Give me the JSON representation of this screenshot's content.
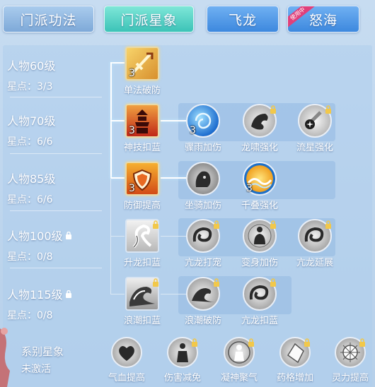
{
  "tabs": [
    {
      "label": "门派功法"
    },
    {
      "label": "门派星象"
    },
    {
      "label": "飞龙"
    },
    {
      "label": "怒海",
      "badge": "使用中"
    }
  ],
  "levels": [
    {
      "label": "人物60级",
      "points": "星点：3/3"
    },
    {
      "label": "人物70级",
      "points": "星点：6/6"
    },
    {
      "label": "人物85级",
      "points": "星点：6/6"
    },
    {
      "label": "人物100级",
      "points": "星点：0/8",
      "locked": true
    },
    {
      "label": "人物115级",
      "points": "星点：0/8",
      "locked": true
    }
  ],
  "skills": {
    "r1": [
      {
        "name": "单法破防",
        "level": "3",
        "icon": "sword-icon"
      }
    ],
    "r2": [
      {
        "name": "神技扣蓝",
        "level": "3",
        "icon": "pagoda-fire-icon"
      },
      {
        "name": "骤雨加伤",
        "level": "3",
        "icon": "swirl-orb-icon"
      },
      {
        "name": "龙啸强化",
        "level": "",
        "icon": "dragon-head-icon",
        "locked": true
      },
      {
        "name": "流星强化",
        "level": "",
        "icon": "meteor-icon",
        "locked": true
      }
    ],
    "r3": [
      {
        "name": "防御提高",
        "level": "3",
        "icon": "shield-fire-icon"
      },
      {
        "name": "坐骑加伤",
        "level": "",
        "icon": "beast-icon"
      },
      {
        "name": "千叠强化",
        "level": "3",
        "icon": "wave-icon"
      }
    ],
    "r4": [
      {
        "name": "升龙扣蓝",
        "level": "",
        "icon": "rising-dragon-icon",
        "locked": true
      },
      {
        "name": "亢龙打宠",
        "level": "",
        "icon": "coiled-dragon-icon",
        "locked": true
      },
      {
        "name": "变身加伤",
        "level": "",
        "icon": "meditate-figure-icon",
        "locked": true
      },
      {
        "name": "亢龙延展",
        "level": "",
        "icon": "coiled-dragon-icon",
        "locked": true
      }
    ],
    "r5": [
      {
        "name": "浪潮扣蓝",
        "level": "",
        "icon": "tidal-wave-icon",
        "locked": true
      },
      {
        "name": "浪潮破防",
        "level": "",
        "icon": "tidal-wave-icon",
        "locked": true
      },
      {
        "name": "亢龙扣蓝",
        "level": "",
        "icon": "coiled-dragon-icon",
        "locked": true
      }
    ]
  },
  "series": {
    "title": "系别星象",
    "status": "未激活",
    "items": [
      {
        "name": "气血提高",
        "icon": "heart-icon"
      },
      {
        "name": "伤害减免",
        "icon": "armored-figure-icon",
        "locked": true
      },
      {
        "name": "凝神聚气",
        "icon": "aura-figure-icon",
        "locked": true
      },
      {
        "name": "药格增加",
        "icon": "gem-icon",
        "locked": true
      },
      {
        "name": "灵力提高",
        "icon": "sparkle-orb-icon",
        "locked": true
      }
    ]
  },
  "colors": {
    "accent": "#3cc3b7",
    "tab_blue": "#3d88de",
    "badge": "#e0407a"
  }
}
